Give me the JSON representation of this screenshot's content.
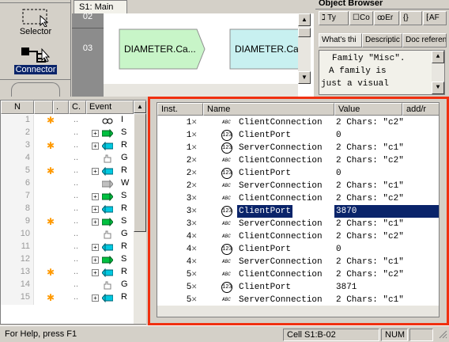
{
  "palette": {
    "tools": [
      {
        "label": "Selector",
        "active": false
      },
      {
        "label": "Connector",
        "active": true
      }
    ]
  },
  "diagram": {
    "tab_label": "S1: Main",
    "rows": [
      "02",
      "03"
    ],
    "shapes": [
      {
        "label": "DIAMETER.Ca...",
        "color": "#c8f5c8"
      },
      {
        "label": "DIAMETER.Ca",
        "color": "#c8f0f0"
      }
    ]
  },
  "object_browser": {
    "title": "Object Browser",
    "toolbar_tabs": [
      "Ty",
      "Co",
      "Er",
      "AF"
    ],
    "tabs": [
      "What's thi",
      "Descriptic",
      "Doc referen"
    ],
    "content_lines": [
      "Family \"Misc\".",
      "A family is",
      "just a visual"
    ]
  },
  "event_grid": {
    "headers": [
      "N",
      "",
      ".",
      "C.",
      "Event"
    ],
    "rows": [
      {
        "n": "1",
        "star": true,
        "plus": false,
        "icon": "glasses",
        "text": "I"
      },
      {
        "n": "2",
        "star": false,
        "plus": true,
        "icon": "green-arrow",
        "text": "S"
      },
      {
        "n": "3",
        "star": true,
        "plus": true,
        "icon": "cyan-arrow",
        "text": "R"
      },
      {
        "n": "4",
        "star": false,
        "plus": false,
        "icon": "hand",
        "text": "G"
      },
      {
        "n": "5",
        "star": true,
        "plus": true,
        "icon": "cyan-arrow",
        "text": "R"
      },
      {
        "n": "6",
        "star": false,
        "plus": false,
        "icon": "gray-arrow",
        "text": "W"
      },
      {
        "n": "7",
        "star": false,
        "plus": true,
        "icon": "green-arrow",
        "text": "S"
      },
      {
        "n": "8",
        "star": false,
        "plus": true,
        "icon": "cyan-arrow",
        "text": "R"
      },
      {
        "n": "9",
        "star": true,
        "plus": true,
        "icon": "green-arrow",
        "text": "S"
      },
      {
        "n": "10",
        "star": false,
        "plus": false,
        "icon": "hand",
        "text": "G"
      },
      {
        "n": "11",
        "star": false,
        "plus": true,
        "icon": "cyan-arrow",
        "text": "R"
      },
      {
        "n": "12",
        "star": false,
        "plus": true,
        "icon": "green-arrow",
        "text": "S"
      },
      {
        "n": "13",
        "star": true,
        "plus": true,
        "icon": "cyan-arrow",
        "text": "R"
      },
      {
        "n": "14",
        "star": false,
        "plus": false,
        "icon": "hand",
        "text": "G"
      },
      {
        "n": "15",
        "star": true,
        "plus": true,
        "icon": "cyan-arrow",
        "text": "R"
      }
    ]
  },
  "properties": {
    "headers": [
      "Inst.",
      "Name",
      "Value",
      "add/r"
    ],
    "rows": [
      {
        "inst": "1",
        "kind": "abc",
        "name": "ClientConnection",
        "value": "2 Chars: \"c2\"",
        "selected": false
      },
      {
        "inst": "1",
        "kind": "123",
        "name": "ClientPort",
        "value": "0",
        "selected": false
      },
      {
        "inst": "1",
        "kind": "123",
        "name": "ServerConnection",
        "value": "2 Chars: \"c1\"",
        "selected": false
      },
      {
        "inst": "2",
        "kind": "abc",
        "name": "ClientConnection",
        "value": "2 Chars: \"c2\"",
        "selected": false
      },
      {
        "inst": "2",
        "kind": "123",
        "name": "ClientPort",
        "value": "0",
        "selected": false
      },
      {
        "inst": "2",
        "kind": "abc",
        "name": "ServerConnection",
        "value": "2 Chars: \"c1\"",
        "selected": false
      },
      {
        "inst": "3",
        "kind": "abc",
        "name": "ClientConnection",
        "value": "2 Chars: \"c2\"",
        "selected": false
      },
      {
        "inst": "3",
        "kind": "123",
        "name": "ClientPort",
        "value": "3870",
        "selected": true
      },
      {
        "inst": "3",
        "kind": "abc",
        "name": "ServerConnection",
        "value": "2 Chars: \"c1\"",
        "selected": false
      },
      {
        "inst": "4",
        "kind": "abc",
        "name": "ClientConnection",
        "value": "2 Chars: \"c2\"",
        "selected": false
      },
      {
        "inst": "4",
        "kind": "123",
        "name": "ClientPort",
        "value": "0",
        "selected": false
      },
      {
        "inst": "4",
        "kind": "abc",
        "name": "ServerConnection",
        "value": "2 Chars: \"c1\"",
        "selected": false
      },
      {
        "inst": "5",
        "kind": "abc",
        "name": "ClientConnection",
        "value": "2 Chars: \"c2\"",
        "selected": false
      },
      {
        "inst": "5",
        "kind": "123",
        "name": "ClientPort",
        "value": "3871",
        "selected": false
      },
      {
        "inst": "5",
        "kind": "abc",
        "name": "ServerConnection",
        "value": "2 Chars: \"c1\"",
        "selected": false
      }
    ],
    "kind_labels": {
      "abc": "ABC",
      "123": "123"
    },
    "highlight_color": "#f03010"
  },
  "statusbar": {
    "help": "For Help, press F1",
    "cell": "Cell S1:B-02",
    "num": "NUM"
  }
}
